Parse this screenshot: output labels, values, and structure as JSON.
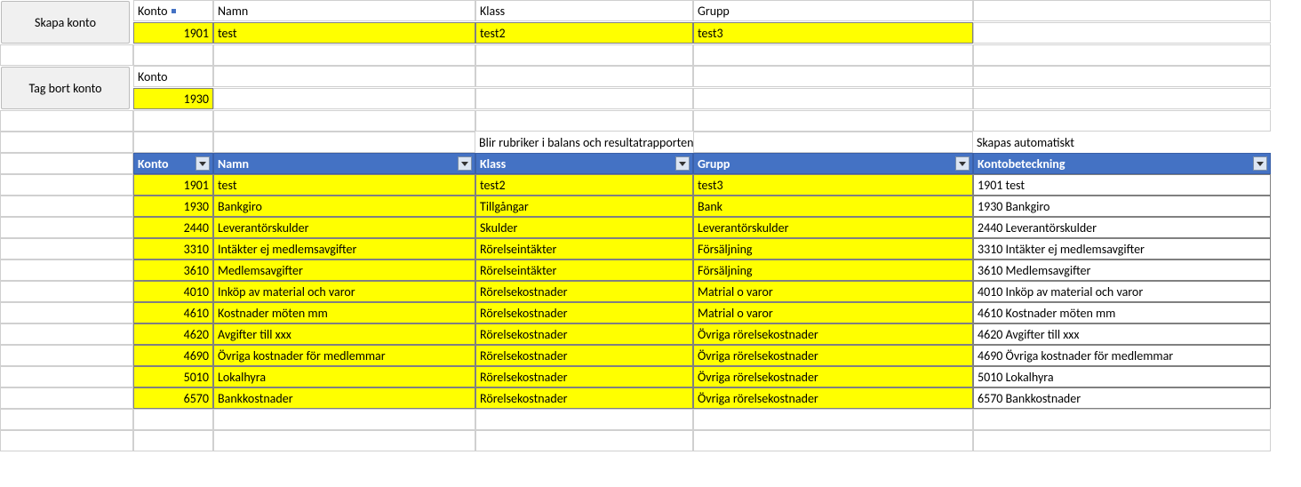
{
  "buttons": {
    "create": "Skapa konto",
    "delete": "Tag bort konto"
  },
  "upper_headers": {
    "konto": "Konto",
    "namn": "Namn",
    "klass": "Klass",
    "grupp": "Grupp"
  },
  "create_row": {
    "konto": "1901",
    "namn": "test",
    "klass": "test2",
    "grupp": "test3"
  },
  "delete_row": {
    "label": "Konto",
    "konto": "1930"
  },
  "captions": {
    "balance": "Blir rubriker i balans och resultatrapporten",
    "auto": "Skapas automatiskt"
  },
  "table_headers": {
    "konto": "Konto",
    "namn": "Namn",
    "klass": "Klass",
    "grupp": "Grupp",
    "beteckning": "Kontobeteckning"
  },
  "rows": [
    {
      "konto": "1901",
      "namn": "test",
      "klass": "test2",
      "grupp": "test3",
      "beteckning": "1901 test"
    },
    {
      "konto": "1930",
      "namn": "Bankgiro",
      "klass": "Tillgångar",
      "grupp": "Bank",
      "beteckning": "1930 Bankgiro"
    },
    {
      "konto": "2440",
      "namn": "Leverantörskulder",
      "klass": "Skulder",
      "grupp": "Leverantörskulder",
      "beteckning": "2440 Leverantörskulder"
    },
    {
      "konto": "3310",
      "namn": "Intäkter ej medlemsavgifter",
      "klass": "Rörelseintäkter",
      "grupp": "Försäljning",
      "beteckning": "3310 Intäkter ej medlemsavgifter"
    },
    {
      "konto": "3610",
      "namn": "Medlemsavgifter",
      "klass": "Rörelseintäkter",
      "grupp": "Försäljning",
      "beteckning": "3610 Medlemsavgifter"
    },
    {
      "konto": "4010",
      "namn": "Inköp av material och varor",
      "klass": "Rörelsekostnader",
      "grupp": "Matrial o varor",
      "beteckning": "4010 Inköp av material och varor"
    },
    {
      "konto": "4610",
      "namn": "Kostnader möten mm",
      "klass": "Rörelsekostnader",
      "grupp": "Matrial o varor",
      "beteckning": "4610 Kostnader möten mm"
    },
    {
      "konto": "4620",
      "namn": "Avgifter till xxx",
      "klass": "Rörelsekostnader",
      "grupp": "Övriga rörelsekostnader",
      "beteckning": "4620 Avgifter till xxx"
    },
    {
      "konto": "4690",
      "namn": "Övriga kostnader för medlemmar",
      "klass": "Rörelsekostnader",
      "grupp": "Övriga rörelsekostnader",
      "beteckning": "4690 Övriga kostnader för medlemmar"
    },
    {
      "konto": "5010",
      "namn": "Lokalhyra",
      "klass": "Rörelsekostnader",
      "grupp": "Övriga rörelsekostnader",
      "beteckning": "5010 Lokalhyra"
    },
    {
      "konto": "6570",
      "namn": "Bankkostnader",
      "klass": "Rörelsekostnader",
      "grupp": "Övriga rörelsekostnader",
      "beteckning": "6570 Bankkostnader"
    }
  ]
}
